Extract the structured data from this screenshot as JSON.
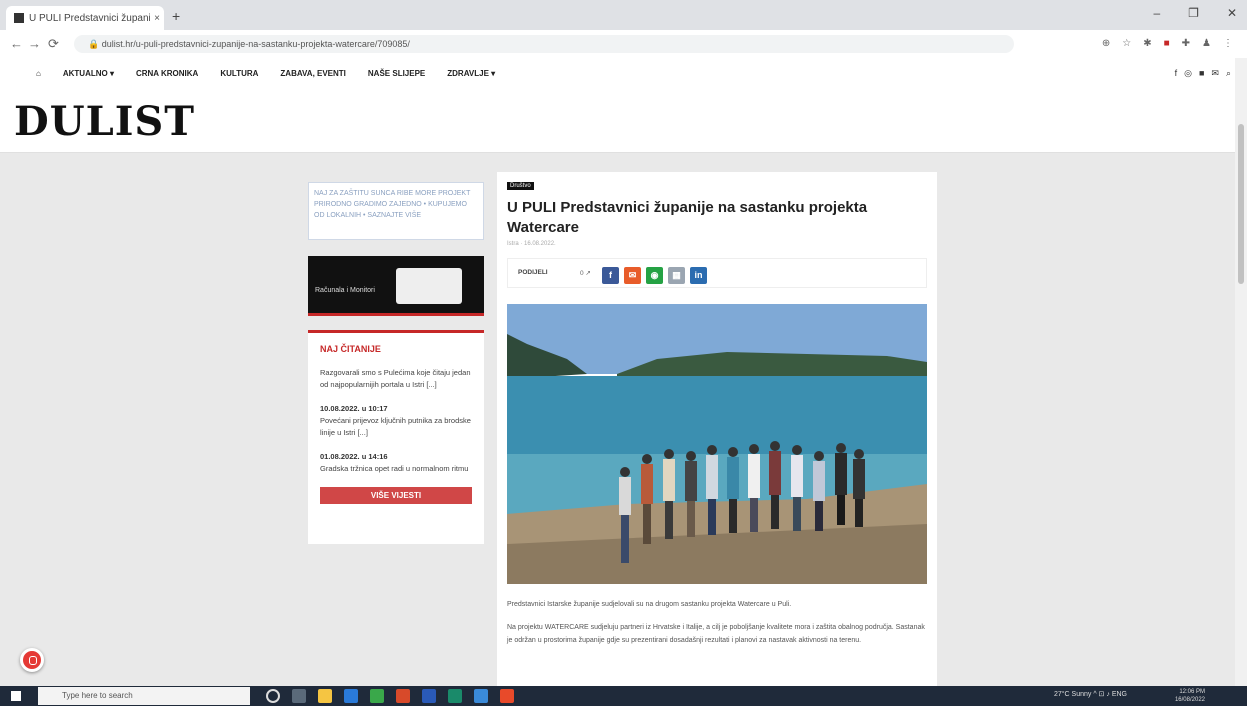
{
  "browser": {
    "tab_title": "U PULI Predstavnici županije n…",
    "tab_close": "×",
    "new_tab": "+",
    "window_controls": [
      "–",
      "❐",
      "✕"
    ],
    "nav": [
      "←",
      "→",
      "⟳",
      "🔒"
    ],
    "url": "dulist.hr/u-puli-predstavnici-zupanije-na-sastanku-projekta-watercare/709085/",
    "extension_icons": [
      "⊕",
      "☆",
      "✱",
      "■",
      "✚",
      "♟",
      "⋮"
    ]
  },
  "site": {
    "nav_items": [
      "⌂",
      "AKTUALNO ▾",
      "CRNA KRONIKA",
      "KULTURA",
      "ZABAVA, EVENTI",
      "NAŠE SLIJEPE",
      "ZDRAVLJE ▾"
    ],
    "social_icons": [
      "f",
      "◎",
      "■",
      "✉",
      "⌕"
    ],
    "logo": "DULIST"
  },
  "sidebar": {
    "ad1_text": "NAJ ZA ZAŠTITU SUNCA RIBE MORE PROJEKT PRIRODNO GRADIMO ZAJEDNO • KUPUJEMO OD LOKALNIH • SAZNAJTE VIŠE",
    "ad2_text": "Računala i Monitori",
    "widget_title": "NAJ ČITANIJE",
    "items": [
      {
        "date": "",
        "text": "Razgovarali smo s Pulećima koje čitaju jedan od najpopularnijih portala u Istri [...]"
      },
      {
        "date": "10.08.2022. u 10:17",
        "text": "Povećani prijevoz ključnih putnika za brodske linije u Istri [...]"
      },
      {
        "date": "01.08.2022. u 14:16",
        "text": "Gradska tržnica opet radi u normalnom ritmu"
      }
    ],
    "more_button": "VIŠE VIJESTI"
  },
  "article": {
    "category": "Društvo",
    "title": "U PULI Predstavnici županije na sastanku projekta Watercare",
    "meta": "Istra · 16.08.2022.",
    "share_label": "PODIJELI",
    "share_count": "0 ↗",
    "share_buttons": [
      {
        "label": "f",
        "color": "#3b5998"
      },
      {
        "label": "✉",
        "color": "#e85c2a"
      },
      {
        "label": "◉",
        "color": "#25a244"
      },
      {
        "label": "▦",
        "color": "#9aa5b1"
      },
      {
        "label": "in",
        "color": "#2b6cb0"
      }
    ],
    "paragraphs": [
      "Predstavnici Istarske županije sudjelovali su na drugom sastanku projekta Watercare u Puli.",
      "Na projektu WATERCARE sudjeluju partneri iz Hrvatske i Italije, a cilj je poboljšanje kvalitete mora i zaštita obalnog područja. Sastanak je održan u prostorima županije gdje su prezentirani dosadašnji rezultati i planovi za nastavak aktivnosti na terenu."
    ]
  },
  "taskbar": {
    "search_placeholder": "Type here to search",
    "tray_text": "27°C Sunny  ^  ⊡  ♪  ENG",
    "clock": "12:06 PM\n16/08/2022"
  }
}
